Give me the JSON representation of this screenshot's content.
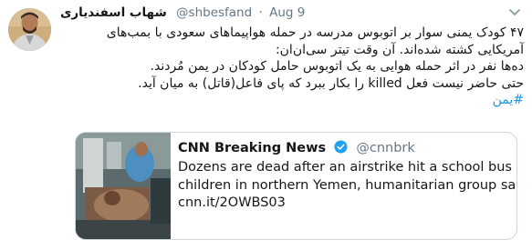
{
  "tweet": {
    "author_name": "شهاب اسفندیاری",
    "author_handle": "@shbesfand",
    "separator": "·",
    "date": "Aug 9",
    "body_lines": [
      "۴۷ کودک یمنی سوار بر اتوبوس مدرسه در حمله هواپیماهای سعودی با بمب‌های",
      "آمریکایی کشته شده‌اند. آن وقت تیتر سی‌ان‌ان:",
      "ده‌ها نفر در اثر حمله هوایی به یک اتوبوس حامل کودکان در یمن مُردند.",
      "حتی حاضر نیست فعل killed را بکار ببرد که پای فاعل(قاتل) به میان آید."
    ],
    "hashtag": "#یمن"
  },
  "quoted": {
    "name": "CNN Breaking News",
    "handle": "@cnnbrk",
    "text_lines": [
      "Dozens are dead after an airstrike hit a school bus carrying",
      "children in northern Yemen, humanitarian group says",
      "cnn.it/2OWBS03"
    ]
  },
  "colors": {
    "link": "#1b95e0",
    "muted": "#657786",
    "border": "#ccd6dd",
    "verified": "#1da1f2"
  },
  "icons": [
    "chevron-down-icon",
    "verified-badge-icon"
  ]
}
